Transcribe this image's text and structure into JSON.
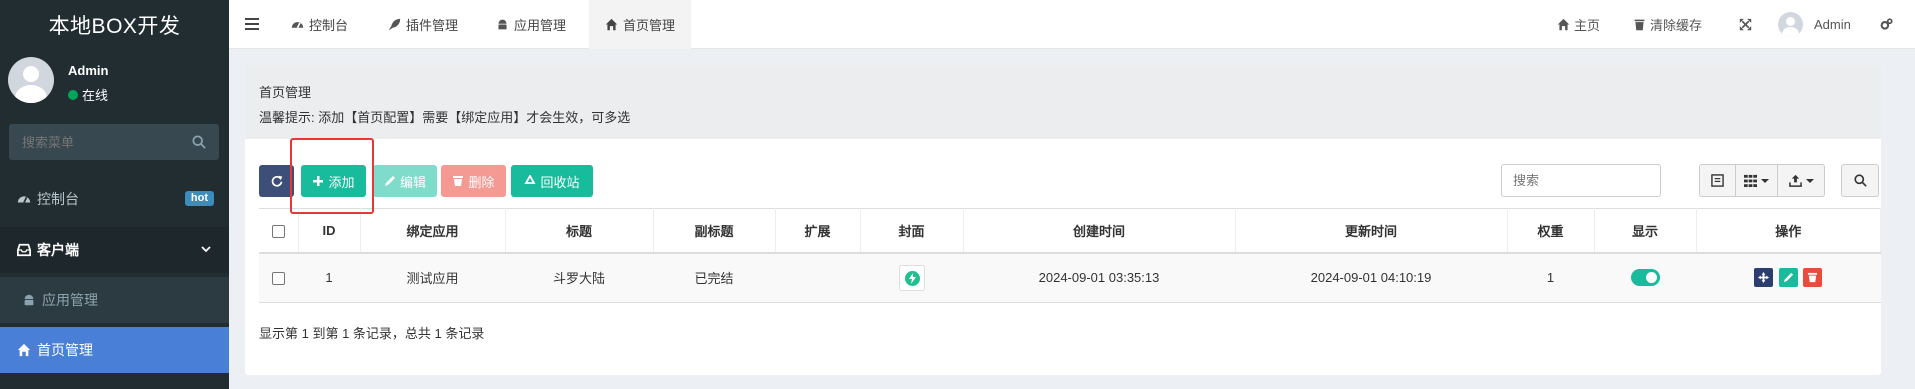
{
  "sidebar": {
    "logo": "本地BOX开发",
    "user": {
      "name": "Admin",
      "status": "在线"
    },
    "search_placeholder": "搜索菜单",
    "items": [
      {
        "label": "控制台",
        "badge": "hot"
      },
      {
        "label": "客户端"
      },
      {
        "label": "应用管理"
      },
      {
        "label": "首页管理"
      }
    ]
  },
  "header": {
    "tabs": [
      {
        "label": "控制台",
        "icon": "dashboard-icon"
      },
      {
        "label": "插件管理",
        "icon": "rocket-icon"
      },
      {
        "label": "应用管理",
        "icon": "android-icon"
      },
      {
        "label": "首页管理",
        "icon": "home-icon",
        "active": true
      }
    ],
    "right": {
      "home": "主页",
      "clear_cache": "清除缓存",
      "user": "Admin"
    }
  },
  "panel": {
    "title": "首页管理",
    "tip": "温馨提示: 添加【首页配置】需要【绑定应用】才会生效，可多选"
  },
  "toolbar": {
    "add": "添加",
    "edit": "编辑",
    "delete": "删除",
    "recycle": "回收站",
    "search_placeholder": "搜索"
  },
  "table": {
    "columns": [
      "ID",
      "绑定应用",
      "标题",
      "副标题",
      "扩展",
      "封面",
      "创建时间",
      "更新时间",
      "权重",
      "显示",
      "操作"
    ],
    "rows": [
      {
        "id": "1",
        "app": "测试应用",
        "title": "斗罗大陆",
        "subtitle": "已完结",
        "ext": "",
        "created": "2024-09-01 03:35:13",
        "updated": "2024-09-01 04:10:19",
        "weight": "1",
        "display": true
      }
    ],
    "summary": "显示第 1 到第 1 条记录，总共 1 条记录"
  },
  "colors": {
    "sidebar_bg": "#222d32",
    "active_nav": "#4a7fd8",
    "primary": "#18bc9c",
    "danger": "#e74c3c",
    "highlight_box": "#e53935"
  }
}
